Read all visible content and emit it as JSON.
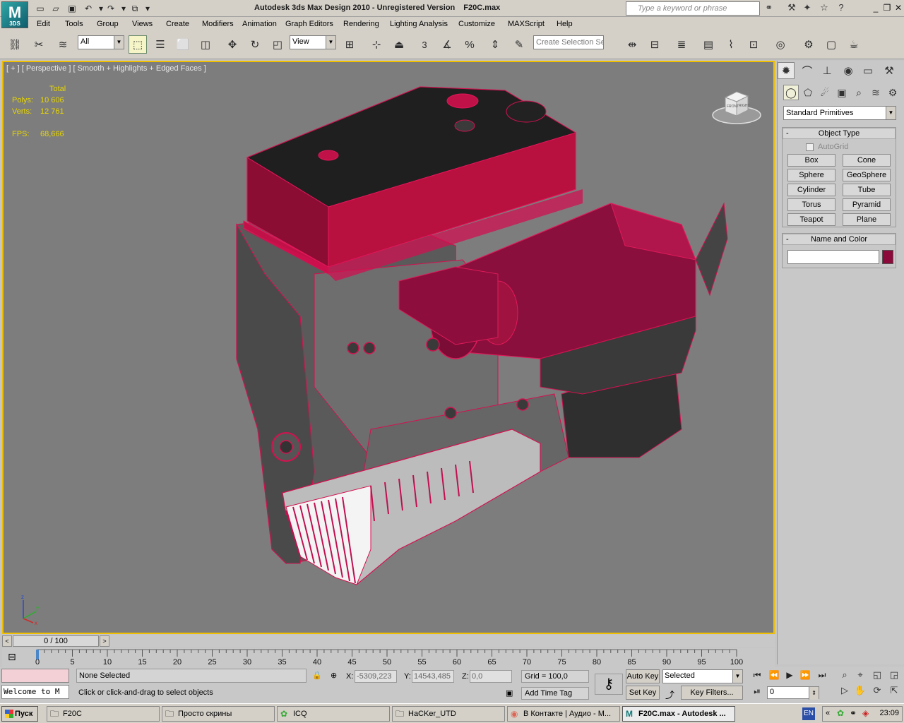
{
  "app": {
    "logo": "M",
    "logo_sub": "3DS",
    "title": "Autodesk 3ds Max Design 2010  - Unregistered Version",
    "file": "F20C.max",
    "search_placeholder": "Type a keyword or phrase"
  },
  "menu": [
    "Edit",
    "Tools",
    "Group",
    "Views",
    "Create",
    "Modifiers",
    "Animation",
    "Graph Editors",
    "Rendering",
    "Lighting Analysis",
    "Customize",
    "MAXScript",
    "Help"
  ],
  "toolbar": {
    "selection_filter": "All",
    "ref_coord": "View",
    "snap_label": "3",
    "create_selection_set": "Create Selection Se"
  },
  "viewport": {
    "label": "[ + ] [ Perspective ] [ Smooth + Highlights + Edged Faces ]",
    "stats_header": "Total",
    "polys_label": "Polys:",
    "polys_value": "10 606",
    "verts_label": "Verts:",
    "verts_value": "12 761",
    "fps_label": "FPS:",
    "fps_value": "68,666",
    "viewcube_front": "FRONT",
    "viewcube_right": "RIGHT",
    "axis": [
      "z",
      "y",
      "x"
    ]
  },
  "command_panel": {
    "category": "Standard Primitives",
    "object_type_title": "Object Type",
    "autogrid": "AutoGrid",
    "primitives": [
      "Box",
      "Cone",
      "Sphere",
      "GeoSphere",
      "Cylinder",
      "Tube",
      "Torus",
      "Pyramid",
      "Teapot",
      "Plane"
    ],
    "name_color_title": "Name and Color",
    "object_color": "#8b0a3a"
  },
  "timeline": {
    "slider_label": "0 / 100",
    "ticks": [
      "0",
      "5",
      "10",
      "15",
      "20",
      "25",
      "30",
      "35",
      "40",
      "45",
      "50",
      "55",
      "60",
      "65",
      "70",
      "75",
      "80",
      "85",
      "90",
      "95",
      "100"
    ]
  },
  "status": {
    "listener": "Welcome to M",
    "selection": "None Selected",
    "prompt": "Click or click-and-drag to select objects",
    "x_label": "X:",
    "x_value": "-5309,223",
    "y_label": "Y:",
    "y_value": "14543,485",
    "z_label": "Z:",
    "z_value": "0,0",
    "grid": "Grid = 100,0",
    "add_time_tag": "Add Time Tag",
    "auto_key": "Auto Key",
    "set_key": "Set Key",
    "key_mode": "Selected",
    "key_filters": "Key Filters...",
    "current_frame": "0"
  },
  "taskbar": {
    "start": "Пуск",
    "tasks": [
      {
        "label": "F20C",
        "icon": "folder-icon"
      },
      {
        "label": "Просто скрины",
        "icon": "folder-icon"
      },
      {
        "label": "ICQ",
        "icon": "icq-icon"
      },
      {
        "label": "HaCKer_UTD",
        "icon": "folder-icon"
      },
      {
        "label": "В Контакте | Аудио - M...",
        "icon": "firefox-icon"
      },
      {
        "label": "F20C.max - Autodesk ...",
        "icon": "max-icon"
      }
    ],
    "lang": "EN",
    "time": "23:09"
  },
  "colors": {
    "viewport_bg": "#7d7d7d",
    "active_border": "#f0c000",
    "stats": "#e8d600",
    "engine": "#b8103f"
  }
}
